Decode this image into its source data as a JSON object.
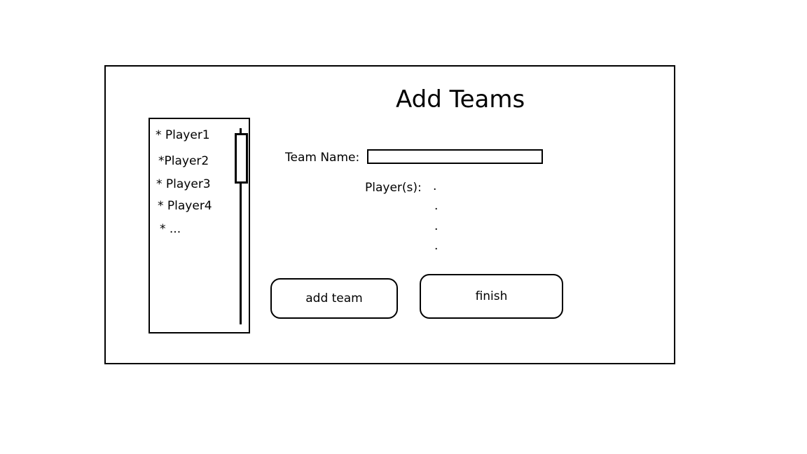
{
  "screen": {
    "title": "Add Teams"
  },
  "player_list": {
    "items": [
      {
        "label": "* Player1"
      },
      {
        "label": "*Player2"
      },
      {
        "label": "* Player3"
      },
      {
        "label": "* Player4"
      },
      {
        "label": "* ..."
      }
    ]
  },
  "form": {
    "team_name_label": "Team Name:",
    "team_name_value": "",
    "players_label": "Player(s):",
    "player_placeholders": [
      ".",
      ".",
      ".",
      "."
    ]
  },
  "actions": {
    "add_team_label": "add team",
    "finish_label": "finish"
  }
}
